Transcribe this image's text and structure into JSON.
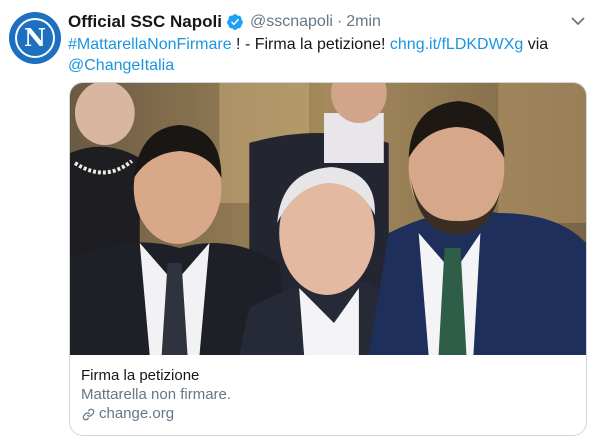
{
  "tweet": {
    "display_name": "Official SSC Napoli",
    "handle": "@sscnapoli",
    "separator": "·",
    "time": "2min",
    "avatar_letter": "N",
    "text_parts": {
      "hashtag": "#MattarellaNonFirmare",
      "middle": " ! - Firma la petizione! ",
      "url": "chng.it/fLDKDWXg",
      "via": " via ",
      "mention": "@ChangeItalia"
    }
  },
  "card": {
    "title": "Firma la petizione",
    "description": "Mattarella non firmare.",
    "domain": "change.org"
  },
  "colors": {
    "link": "#1b95e0",
    "secondary_text": "#657786",
    "verified": "#1da1f2",
    "avatar_bg": "#1d6fc0"
  },
  "icons": [
    "verified-badge-icon",
    "chevron-down-icon",
    "link-icon"
  ]
}
